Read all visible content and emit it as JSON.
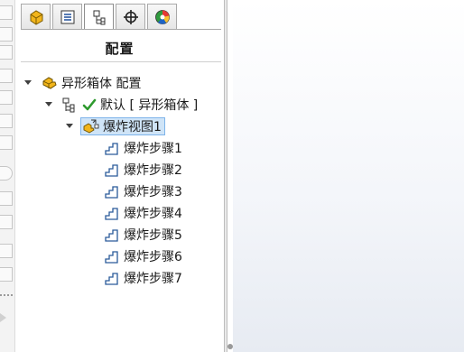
{
  "panel": {
    "title": "配置",
    "tabs": [
      {
        "icon": "feature-manager-icon",
        "active": false
      },
      {
        "icon": "property-manager-icon",
        "active": false
      },
      {
        "icon": "configuration-manager-icon",
        "active": true
      },
      {
        "icon": "dimxpert-manager-icon",
        "active": false
      },
      {
        "icon": "display-manager-icon",
        "active": false
      }
    ]
  },
  "tree": {
    "root_label": "异形箱体 配置",
    "config_label": "默认 [ 异形箱体 ]",
    "explode_view_label": "爆炸视图1",
    "steps": [
      "爆炸步骤1",
      "爆炸步骤2",
      "爆炸步骤3",
      "爆炸步骤4",
      "爆炸步骤5",
      "爆炸步骤6",
      "爆炸步骤7"
    ]
  },
  "colors": {
    "selection_bg": "#cfe4f7",
    "selection_border": "#7eb4ea",
    "part_icon_yellow": "#f2b51b",
    "check_green": "#2e9a2e",
    "step_icon_blue": "#2a5a9a"
  }
}
